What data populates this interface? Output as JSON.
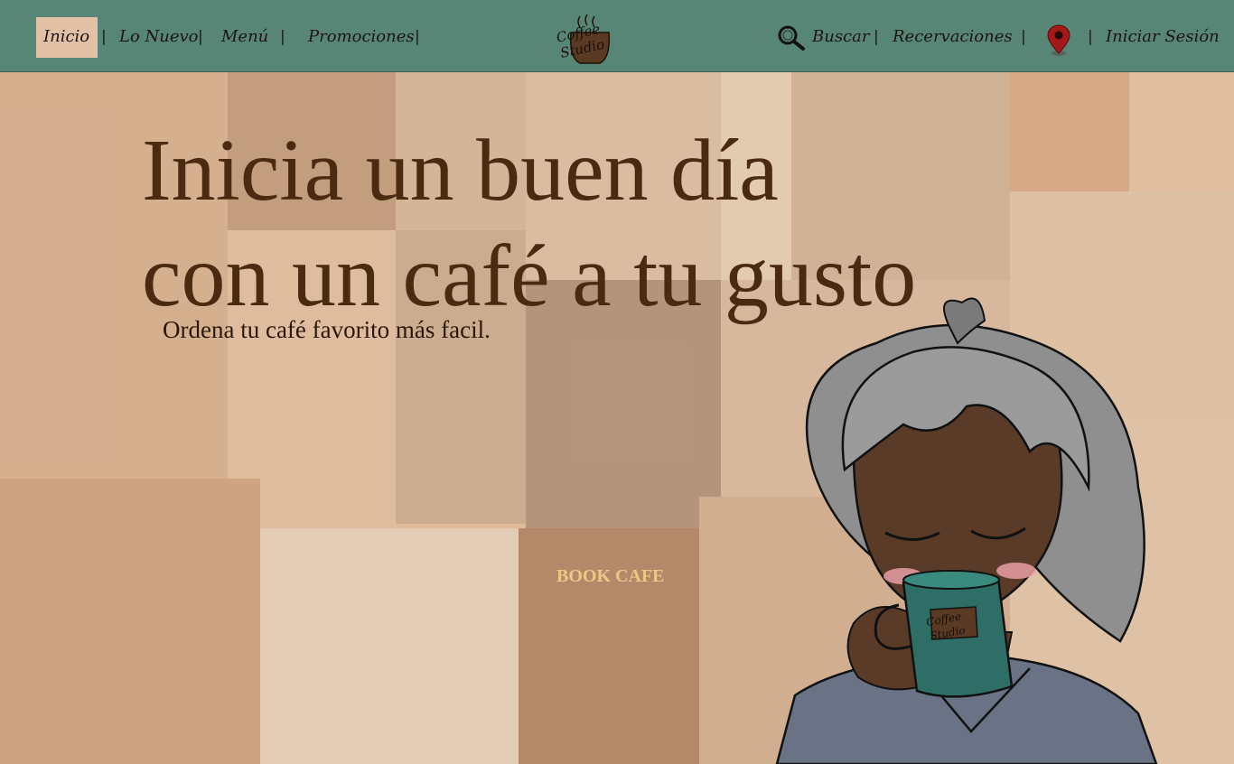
{
  "nav": {
    "left_items": [
      {
        "label": "Inicio",
        "active": true
      },
      {
        "label": "Lo Nuevo"
      },
      {
        "label": "Menú"
      },
      {
        "label": "Promociones"
      }
    ],
    "search_label": "Buscar",
    "reservations_label": "Recervaciones",
    "login_label": "Iniciar Sesión",
    "separator": "|",
    "icons": {
      "search": "search-icon",
      "location": "location-pin-icon"
    }
  },
  "logo": {
    "text_line1": "Coffee",
    "text_line2": "Studio"
  },
  "hero": {
    "title_line1": "Inicia un buen día",
    "title_line2": "con un café a tu gusto",
    "subtitle": "Ordena tu café favorito más facil."
  },
  "collage": {
    "book_cafe_sign": "BOOK CAFE"
  },
  "mug": {
    "text_line1": "Coffee",
    "text_line2": "Studio"
  },
  "colors": {
    "nav_bg": "#588676",
    "active_tab_bg": "#e2c1a7",
    "headline": "#4a2b12",
    "pin": "#a31818",
    "mug": "#2e6e66"
  }
}
